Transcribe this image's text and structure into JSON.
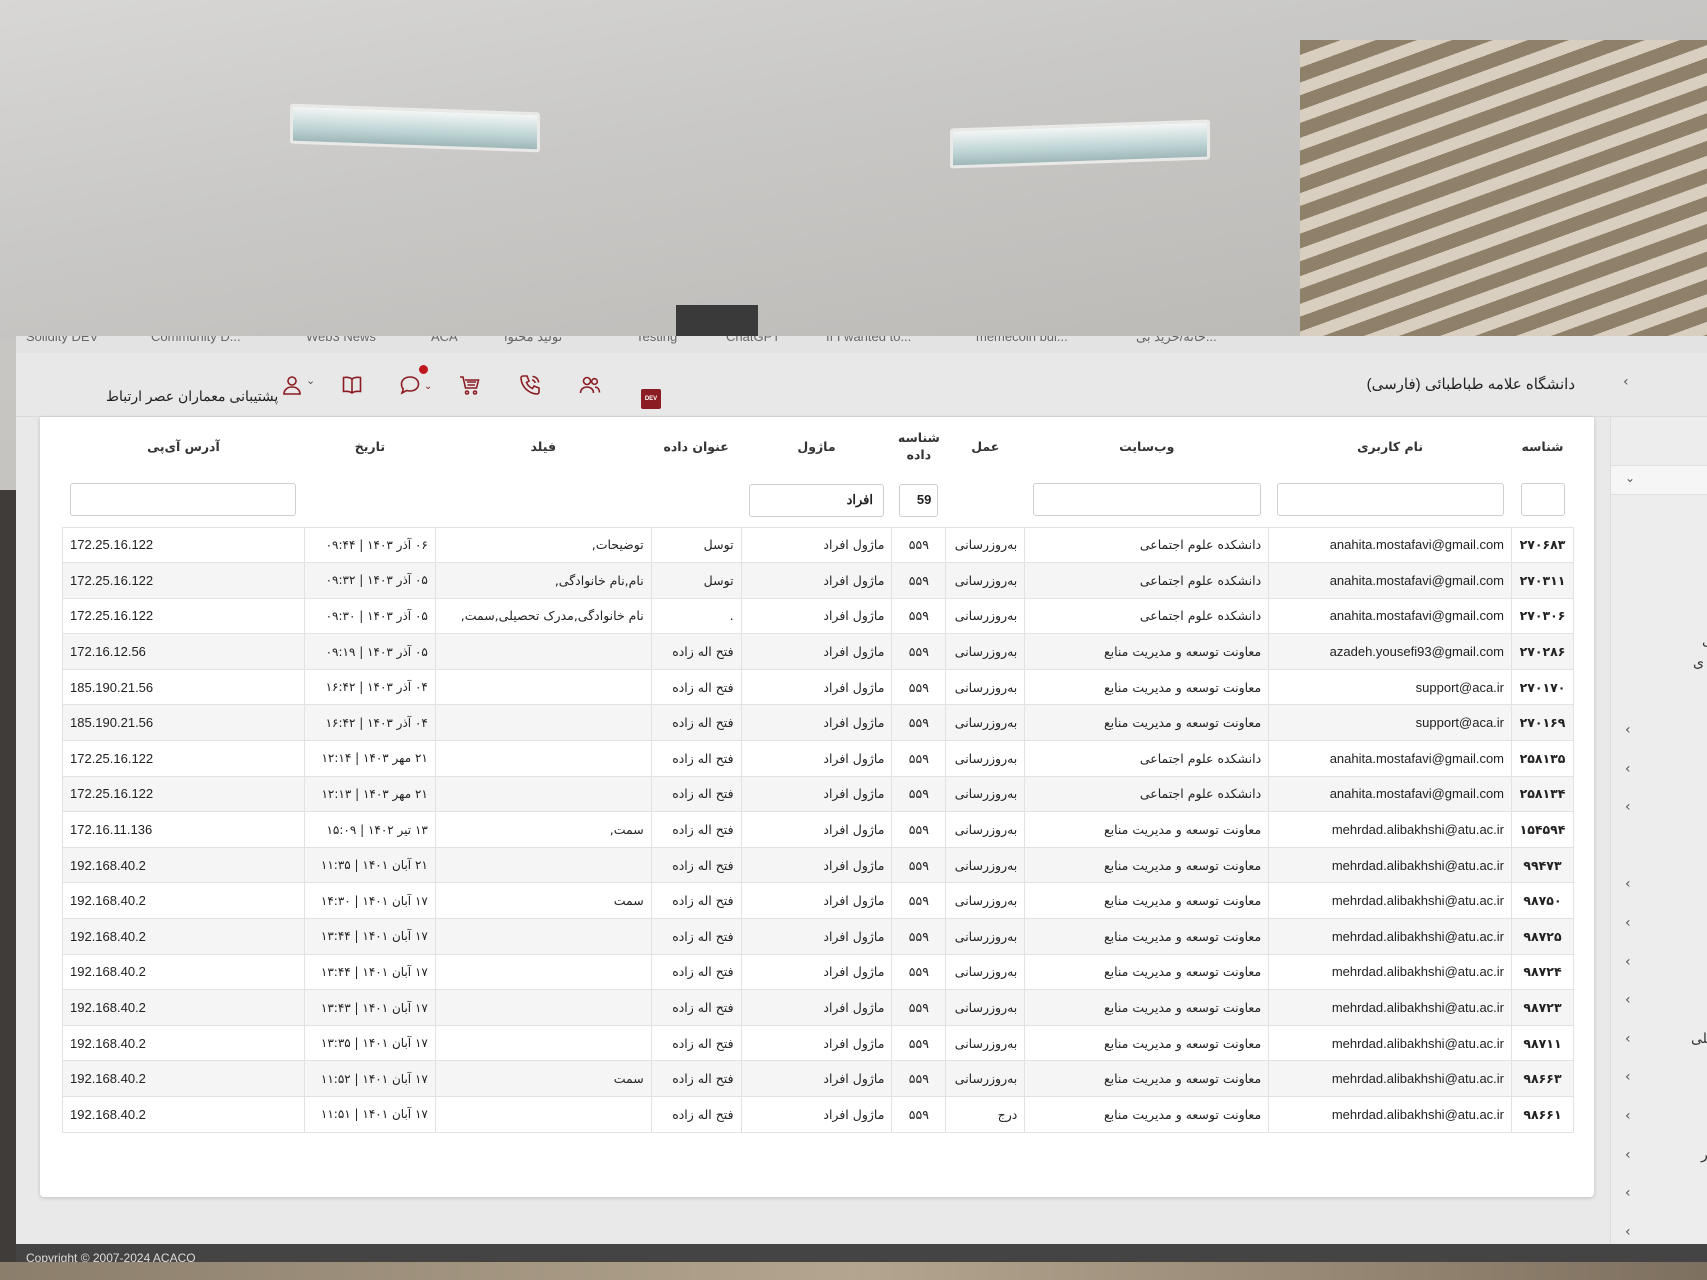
{
  "bookmarks": [
    "Solidity DEV",
    "Community D...",
    "Web3 News",
    "ACA",
    "تولید محتوا",
    "Testing",
    "ChatGPT",
    "If I wanted to...",
    "memecoin bui...",
    "خانه/خرید بی..."
  ],
  "header": {
    "site_title": "دانشگاه علامه طباطبائی (فارسی)",
    "support_label": "پشتیبانی معماران عصر ارتباط",
    "dev_badge": "DEV",
    "icons": [
      "dev-icon",
      "users-icon",
      "phone-icon",
      "cart-icon",
      "chat-icon",
      "book-icon",
      "user-icon"
    ]
  },
  "right_panel": {
    "texts": [
      "ی",
      "ی",
      "صیلی",
      "یر"
    ]
  },
  "table": {
    "columns": [
      "شناسه",
      "نام کاربری",
      "وب‌سایت",
      "عمل",
      "شناسه داده",
      "ماژول",
      "عنوان داده",
      "فیلد",
      "تاریخ",
      "آدرس آی‌پی"
    ],
    "filters": {
      "id": "",
      "username": "",
      "website": "",
      "data_id": "59",
      "module": "افراد",
      "ip": ""
    },
    "rows": [
      [
        "۲۷۰۶۸۳",
        "anahita.mostafavi@gmail.com",
        "دانشکده علوم اجتماعی",
        "به‌روزرسانی",
        "۵۵۹",
        "ماژول افراد",
        "توسل",
        "توضیحات,",
        "۰۶ آذر ۱۴۰۳ | ۰۹:۴۴",
        "172.25.16.122"
      ],
      [
        "۲۷۰۳۱۱",
        "anahita.mostafavi@gmail.com",
        "دانشکده علوم اجتماعی",
        "به‌روزرسانی",
        "۵۵۹",
        "ماژول افراد",
        "توسل",
        "نام,نام خانوادگی,",
        "۰۵ آذر ۱۴۰۳ | ۰۹:۳۲",
        "172.25.16.122"
      ],
      [
        "۲۷۰۳۰۶",
        "anahita.mostafavi@gmail.com",
        "دانشکده علوم اجتماعی",
        "به‌روزرسانی",
        "۵۵۹",
        "ماژول افراد",
        ".",
        "نام خانوادگی,مدرک تحصیلی,سمت,",
        "۰۵ آذر ۱۴۰۳ | ۰۹:۳۰",
        "172.25.16.122"
      ],
      [
        "۲۷۰۲۸۶",
        "azadeh.yousefi93@gmail.com",
        "معاونت توسعه و مدیریت منابع",
        "به‌روزرسانی",
        "۵۵۹",
        "ماژول افراد",
        "فتح اله زاده",
        "",
        "۰۵ آذر ۱۴۰۳ | ۰۹:۱۹",
        "172.16.12.56"
      ],
      [
        "۲۷۰۱۷۰",
        "support@aca.ir",
        "معاونت توسعه و مدیریت منابع",
        "به‌روزرسانی",
        "۵۵۹",
        "ماژول افراد",
        "فتح اله زاده",
        "",
        "۰۴ آذر ۱۴۰۳ | ۱۶:۴۲",
        "185.190.21.56"
      ],
      [
        "۲۷۰۱۶۹",
        "support@aca.ir",
        "معاونت توسعه و مدیریت منابع",
        "به‌روزرسانی",
        "۵۵۹",
        "ماژول افراد",
        "فتح اله زاده",
        "",
        "۰۴ آذر ۱۴۰۳ | ۱۶:۴۲",
        "185.190.21.56"
      ],
      [
        "۲۵۸۱۳۵",
        "anahita.mostafavi@gmail.com",
        "دانشکده علوم اجتماعی",
        "به‌روزرسانی",
        "۵۵۹",
        "ماژول افراد",
        "فتح اله زاده",
        "",
        "۲۱ مهر ۱۴۰۳ | ۱۲:۱۴",
        "172.25.16.122"
      ],
      [
        "۲۵۸۱۳۴",
        "anahita.mostafavi@gmail.com",
        "دانشکده علوم اجتماعی",
        "به‌روزرسانی",
        "۵۵۹",
        "ماژول افراد",
        "فتح اله زاده",
        "",
        "۲۱ مهر ۱۴۰۳ | ۱۲:۱۳",
        "172.25.16.122"
      ],
      [
        "۱۵۴۵۹۴",
        "mehrdad.alibakhshi@atu.ac.ir",
        "معاونت توسعه و مدیریت منابع",
        "به‌روزرسانی",
        "۵۵۹",
        "ماژول افراد",
        "فتح اله زاده",
        "سمت,",
        "۱۳ تیر ۱۴۰۲ | ۱۵:۰۹",
        "172.16.11.136"
      ],
      [
        "۹۹۴۷۳",
        "mehrdad.alibakhshi@atu.ac.ir",
        "معاونت توسعه و مدیریت منابع",
        "به‌روزرسانی",
        "۵۵۹",
        "ماژول افراد",
        "فتح اله زاده",
        "",
        "۲۱ آبان ۱۴۰۱ | ۱۱:۳۵",
        "192.168.40.2"
      ],
      [
        "۹۸۷۵۰",
        "mehrdad.alibakhshi@atu.ac.ir",
        "معاونت توسعه و مدیریت منابع",
        "به‌روزرسانی",
        "۵۵۹",
        "ماژول افراد",
        "فتح اله زاده",
        "سمت",
        "۱۷ آبان ۱۴۰۱ | ۱۴:۳۰",
        "192.168.40.2"
      ],
      [
        "۹۸۷۲۵",
        "mehrdad.alibakhshi@atu.ac.ir",
        "معاونت توسعه و مدیریت منابع",
        "به‌روزرسانی",
        "۵۵۹",
        "ماژول افراد",
        "فتح اله زاده",
        "",
        "۱۷ آبان ۱۴۰۱ | ۱۳:۴۴",
        "192.168.40.2"
      ],
      [
        "۹۸۷۲۴",
        "mehrdad.alibakhshi@atu.ac.ir",
        "معاونت توسعه و مدیریت منابع",
        "به‌روزرسانی",
        "۵۵۹",
        "ماژول افراد",
        "فتح اله زاده",
        "",
        "۱۷ آبان ۱۴۰۱ | ۱۳:۴۴",
        "192.168.40.2"
      ],
      [
        "۹۸۷۲۳",
        "mehrdad.alibakhshi@atu.ac.ir",
        "معاونت توسعه و مدیریت منابع",
        "به‌روزرسانی",
        "۵۵۹",
        "ماژول افراد",
        "فتح اله زاده",
        "",
        "۱۷ آبان ۱۴۰۱ | ۱۳:۴۳",
        "192.168.40.2"
      ],
      [
        "۹۸۷۱۱",
        "mehrdad.alibakhshi@atu.ac.ir",
        "معاونت توسعه و مدیریت منابع",
        "به‌روزرسانی",
        "۵۵۹",
        "ماژول افراد",
        "فتح اله زاده",
        "",
        "۱۷ آبان ۱۴۰۱ | ۱۳:۳۵",
        "192.168.40.2"
      ],
      [
        "۹۸۶۶۳",
        "mehrdad.alibakhshi@atu.ac.ir",
        "معاونت توسعه و مدیریت منابع",
        "به‌روزرسانی",
        "۵۵۹",
        "ماژول افراد",
        "فتح اله زاده",
        "سمت",
        "۱۷ آبان ۱۴۰۱ | ۱۱:۵۲",
        "192.168.40.2"
      ],
      [
        "۹۸۶۶۱",
        "mehrdad.alibakhshi@atu.ac.ir",
        "معاونت توسعه و مدیریت منابع",
        "درج",
        "۵۵۹",
        "ماژول افراد",
        "فتح اله زاده",
        "",
        "۱۷ آبان ۱۴۰۱ | ۱۱:۵۱",
        "192.168.40.2"
      ]
    ]
  },
  "footer": {
    "copyright": "Copyright © 2007-2024 ACACO"
  }
}
